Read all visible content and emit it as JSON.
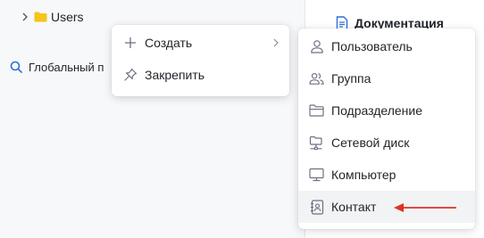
{
  "tree": {
    "users_label": "Users"
  },
  "search": {
    "label": "Глобальный п"
  },
  "docs": {
    "label": "Документация"
  },
  "context_menu": {
    "items": [
      {
        "label": "Создать",
        "icon": "plus-icon"
      },
      {
        "label": "Закрепить",
        "icon": "pin-icon"
      }
    ]
  },
  "create_submenu": {
    "items": [
      {
        "label": "Пользователь",
        "icon": "user-icon"
      },
      {
        "label": "Группа",
        "icon": "group-icon"
      },
      {
        "label": "Подразделение",
        "icon": "folder-outline-icon"
      },
      {
        "label": "Сетевой диск",
        "icon": "network-drive-icon"
      },
      {
        "label": "Компьютер",
        "icon": "monitor-icon"
      },
      {
        "label": "Контакт",
        "icon": "contact-card-icon"
      }
    ],
    "highlighted": "Контакт"
  },
  "colors": {
    "accent_blue": "#2f6fde",
    "folder_yellow": "#f5c518",
    "annotation_red": "#e0321f",
    "icon_gray": "#6b7280"
  }
}
